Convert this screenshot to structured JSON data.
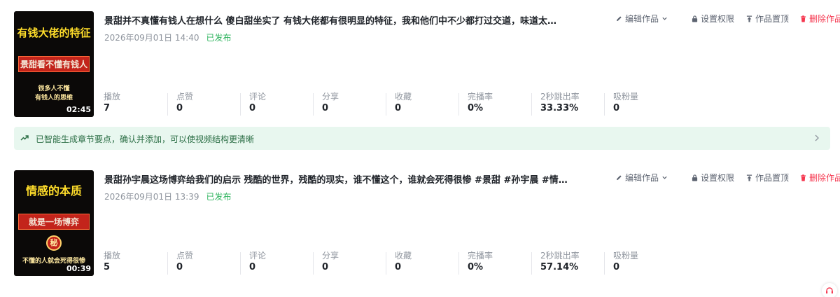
{
  "colors": {
    "published_status": "#2db35d",
    "delete_action": "#f5374f",
    "banner_bg": "#e8f7ef",
    "banner_text": "#2b6e45"
  },
  "items": [
    {
      "thumbnail": {
        "line1": "有钱大佬的特征",
        "line2": "景甜看不懂有钱人",
        "line3": "很多人不懂",
        "line4": "有钱人的思维",
        "duration": "02:45"
      },
      "title": "景甜并不真懂有钱人在想什么 傻白甜坐实了 有钱大佬都有很明显的特征，我和他们中不少都打过交道，味道太…",
      "date": "2026年09月01日 14:40",
      "status": "已发布",
      "actions": {
        "edit": "编辑作品",
        "permissions": "设置权限",
        "pin": "作品置顶",
        "delete": "删除作品"
      },
      "stats": [
        {
          "label": "播放",
          "value": "7"
        },
        {
          "label": "点赞",
          "value": "0"
        },
        {
          "label": "评论",
          "value": "0"
        },
        {
          "label": "分享",
          "value": "0"
        },
        {
          "label": "收藏",
          "value": "0"
        },
        {
          "label": "完播率",
          "value": "0%"
        },
        {
          "label": "2秒跳出率",
          "value": "33.33%"
        },
        {
          "label": "吸粉量",
          "value": "0"
        }
      ]
    },
    {
      "thumbnail": {
        "line1": "情感的本质",
        "line2": "就是一场博弈",
        "seal": "秘",
        "line3": "不懂的人就会死得很惨",
        "duration": "00:39"
      },
      "title": "景甜孙宇晨这场博弈给我们的启示 残酷的世界，残酷的现实，谁不懂这个，谁就会死得很惨 #景甜 #孙宇晨 #情…",
      "date": "2026年09月01日 13:39",
      "status": "已发布",
      "actions": {
        "edit": "编辑作品",
        "permissions": "设置权限",
        "pin": "作品置顶",
        "delete": "删除作品"
      },
      "stats": [
        {
          "label": "播放",
          "value": "5"
        },
        {
          "label": "点赞",
          "value": "0"
        },
        {
          "label": "评论",
          "value": "0"
        },
        {
          "label": "分享",
          "value": "0"
        },
        {
          "label": "收藏",
          "value": "0"
        },
        {
          "label": "完播率",
          "value": "0%"
        },
        {
          "label": "2秒跳出率",
          "value": "57.14%"
        },
        {
          "label": "吸粉量",
          "value": "0"
        }
      ]
    }
  ],
  "banner": {
    "icon": "trend-up-icon",
    "text": "已智能生成章节要点，确认并添加，可以使视频结构更清晰"
  },
  "icons": {
    "edit": "pencil-icon",
    "edit_menu": "chevron-down-icon",
    "permissions": "lock-icon",
    "pin": "pin-top-icon",
    "delete": "trash-icon",
    "banner_more": "chevron-right-icon",
    "support": "headset-icon"
  }
}
